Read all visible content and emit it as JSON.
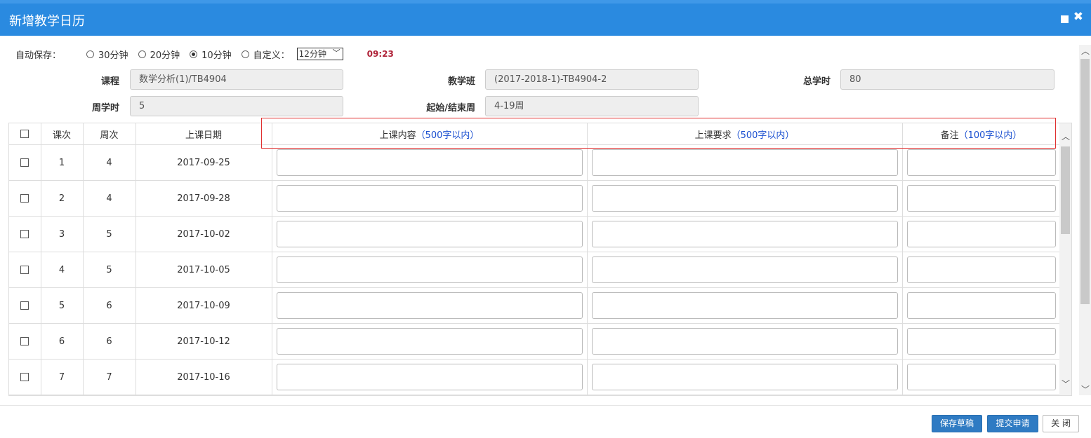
{
  "dialog": {
    "title": "新增教学日历"
  },
  "autosave": {
    "label": "自动保存：",
    "options": [
      {
        "label": "30分钟",
        "selected": false
      },
      {
        "label": "20分钟",
        "selected": false
      },
      {
        "label": "10分钟",
        "selected": true
      },
      {
        "label": "自定义：",
        "selected": false
      }
    ],
    "custom_value": "12分钟",
    "countdown": "09:23"
  },
  "info": {
    "course_label": "课程",
    "course_value": "数学分析(1)/TB4904",
    "class_label": "教学班",
    "class_value": "(2017-2018-1)-TB4904-2",
    "total_hours_label": "总学时",
    "total_hours_value": "80",
    "weekly_hours_label": "周学时",
    "weekly_hours_value": "5",
    "weeks_label": "起始/结束周",
    "weeks_value": "4-19周"
  },
  "table": {
    "headers": {
      "lesson": "课次",
      "week": "周次",
      "date": "上课日期",
      "content": "上课内容",
      "content_hint": "（500字以内）",
      "requirement": "上课要求",
      "requirement_hint": "（500字以内）",
      "remark": "备注",
      "remark_hint": "（100字以内）"
    },
    "rows": [
      {
        "lesson": "1",
        "week": "4",
        "date": "2017-09-25"
      },
      {
        "lesson": "2",
        "week": "4",
        "date": "2017-09-28"
      },
      {
        "lesson": "3",
        "week": "5",
        "date": "2017-10-02"
      },
      {
        "lesson": "4",
        "week": "5",
        "date": "2017-10-05"
      },
      {
        "lesson": "5",
        "week": "6",
        "date": "2017-10-09"
      },
      {
        "lesson": "6",
        "week": "6",
        "date": "2017-10-12"
      },
      {
        "lesson": "7",
        "week": "7",
        "date": "2017-10-16"
      },
      {
        "lesson": "",
        "week": "",
        "date": ""
      }
    ]
  },
  "footer": {
    "save_draft": "保存草稿",
    "submit": "提交申请",
    "close": "关 闭"
  }
}
